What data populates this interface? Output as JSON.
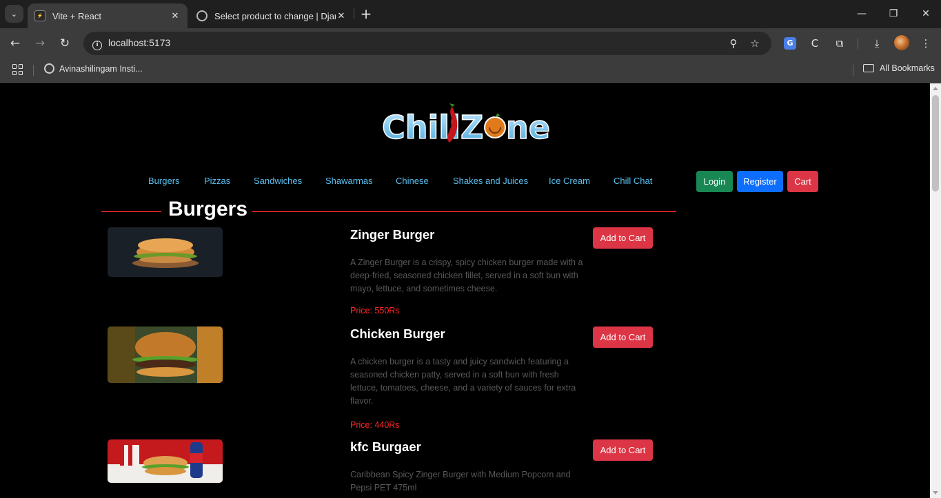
{
  "browser": {
    "tabs": [
      {
        "title": "Vite + React",
        "active": true
      },
      {
        "title": "Select product to change | Djan",
        "active": false
      }
    ],
    "url": "localhost:5173",
    "bookmarks": [
      {
        "label": "Avinashilingam Insti..."
      }
    ],
    "all_bookmarks_label": "All Bookmarks"
  },
  "site": {
    "logo_text": "ChillZone",
    "nav": [
      "Burgers",
      "Pizzas",
      "Sandwiches",
      "Shawarmas",
      "Chinese",
      "Shakes and Juices",
      "Ice Cream",
      "Chill Chat"
    ],
    "buttons": {
      "login": "Login",
      "register": "Register",
      "cart": "Cart"
    },
    "colors": {
      "login": "#198754",
      "register": "#0d6efd",
      "cart": "#dc3545",
      "nav_link": "#5bc0f0",
      "price": "#ff2a2a",
      "section_line": "#c72323"
    }
  },
  "section": {
    "title": "Burgers"
  },
  "products": [
    {
      "name": "Zinger Burger",
      "description": "A Zinger Burger is a crispy, spicy chicken burger made with a deep-fried, seasoned chicken fillet, served in a soft bun with mayo, lettuce, and sometimes cheese.",
      "price": "Price: 550Rs",
      "button": "Add to Cart"
    },
    {
      "name": "Chicken Burger",
      "description": "A chicken burger is a tasty and juicy sandwich featuring a seasoned chicken patty, served in a soft bun with fresh lettuce, tomatoes, cheese, and a variety of sauces for extra flavor.",
      "price": "Price: 440Rs",
      "button": "Add to Cart"
    },
    {
      "name": "kfc Burgaer",
      "description": "Caribbean Spicy Zinger Burger with Medium Popcorn and Pepsi PET 475ml",
      "price": "",
      "button": "Add to Cart"
    }
  ]
}
